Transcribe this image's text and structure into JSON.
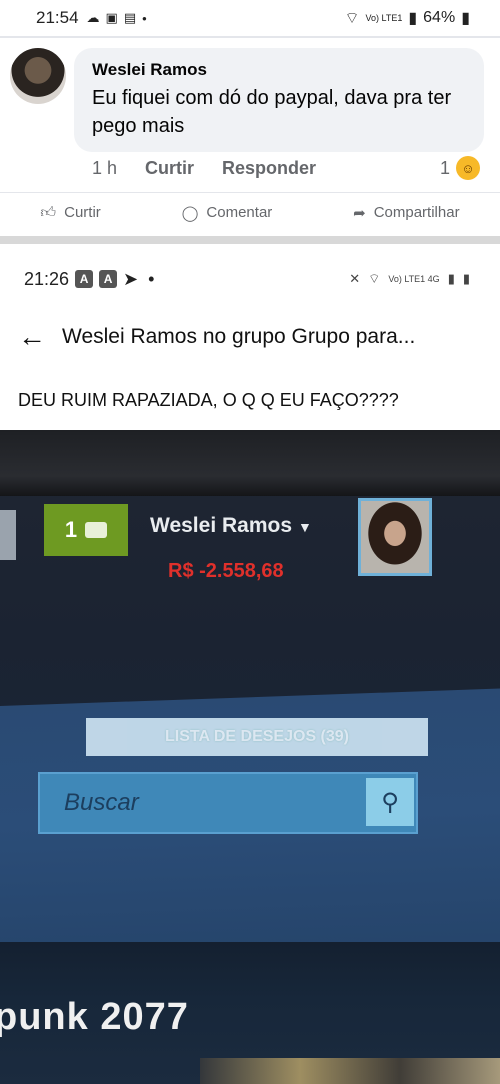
{
  "status1": {
    "time": "21:54",
    "network": "Vo) LTE1",
    "battery": "64%"
  },
  "comment": {
    "author": "Weslei Ramos",
    "text": "Eu fiquei com dó do paypal, dava pra ter pego mais",
    "time": "1 h",
    "like": "Curtir",
    "reply": "Responder",
    "reaction_count": "1"
  },
  "postbar": {
    "like": "Curtir",
    "comment": "Comentar",
    "share": "Compartilhar"
  },
  "status2": {
    "time": "21:26",
    "badge_a": "A",
    "badge_b": "A",
    "network": "Vo) LTE1 4G"
  },
  "header": {
    "title": "Weslei Ramos no grupo Grupo para..."
  },
  "post": {
    "text": "DEU RUIM RAPAZIADA, O Q Q EU FAÇO????"
  },
  "steam": {
    "notif_count": "1",
    "username": "Weslei Ramos",
    "balance": "R$ -2.558,68",
    "wishlist": "LISTA DE DESEJOS (39)",
    "search_placeholder": "Buscar",
    "game_title": "punk 2077"
  },
  "colors": {
    "balance": "#e0302b",
    "notif_bg": "#6e9a22",
    "search_bg": "#3f88b8"
  }
}
